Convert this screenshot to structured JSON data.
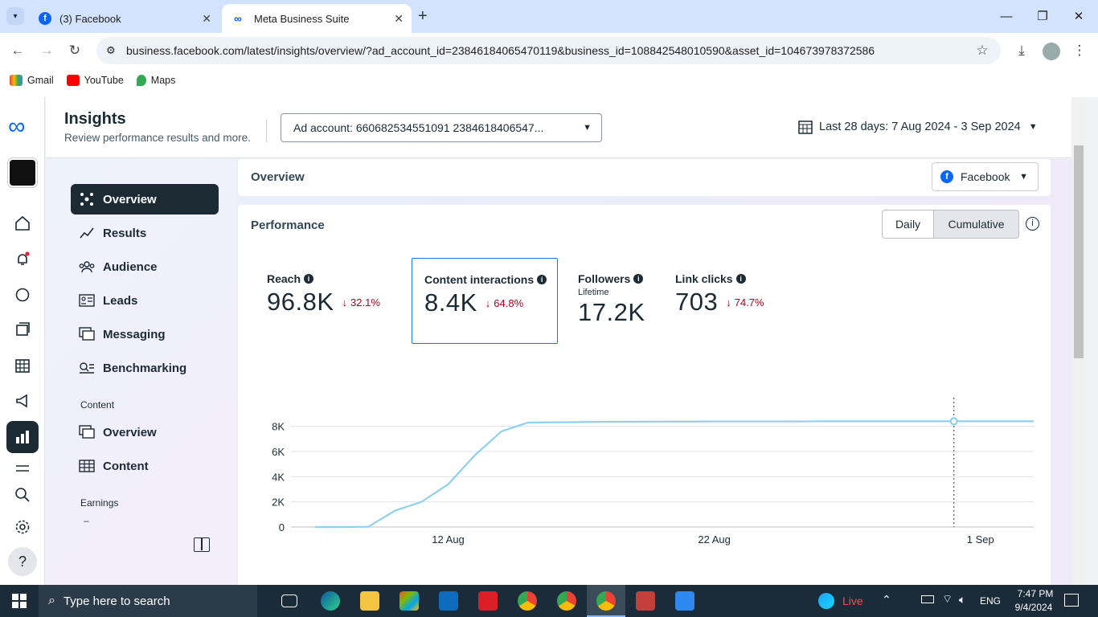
{
  "browser": {
    "tabs": [
      {
        "title": "(3) Facebook",
        "active": false
      },
      {
        "title": "Meta Business Suite",
        "active": true
      }
    ],
    "url": "business.facebook.com/latest/insights/overview/?ad_account_id=23846184065470119&business_id=108842548010590&asset_id=104673978372586",
    "bookmarks": [
      "Gmail",
      "YouTube",
      "Maps"
    ]
  },
  "header": {
    "title": "Insights",
    "subtitle": "Review performance results and more.",
    "ad_account": "Ad account: 660682534551091 2384618406547...",
    "date_range": "Last 28 days: 7 Aug 2024 - 3 Sep 2024"
  },
  "sidenav": {
    "items": [
      {
        "label": "Overview",
        "icon": "overview-icon",
        "active": true
      },
      {
        "label": "Results",
        "icon": "results-icon"
      },
      {
        "label": "Audience",
        "icon": "audience-icon"
      },
      {
        "label": "Leads",
        "icon": "leads-icon"
      },
      {
        "label": "Messaging",
        "icon": "messaging-icon"
      },
      {
        "label": "Benchmarking",
        "icon": "benchmarking-icon"
      }
    ],
    "content_section": "Content",
    "content_items": [
      {
        "label": "Overview",
        "icon": "content-overview-icon"
      },
      {
        "label": "Content",
        "icon": "content-table-icon"
      }
    ],
    "earnings_section": "Earnings",
    "earnings_dash": "–"
  },
  "overview": {
    "title": "Overview",
    "platform": "Facebook"
  },
  "performance": {
    "title": "Performance",
    "toggle": [
      "Daily",
      "Cumulative"
    ],
    "toggle_selected": "Cumulative",
    "metrics": [
      {
        "label": "Reach",
        "value": "96.8K",
        "delta": "32.1%",
        "selected": false
      },
      {
        "label": "Content interactions",
        "value": "8.4K",
        "delta": "64.8%",
        "selected": true
      },
      {
        "label": "Followers",
        "sublabel": "Lifetime",
        "value": "17.2K",
        "delta": ""
      },
      {
        "label": "Link clicks",
        "value": "703",
        "delta": "74.7%",
        "selected": false
      }
    ]
  },
  "chart_data": {
    "type": "line",
    "x": [
      "7 Aug",
      "8 Aug",
      "9 Aug",
      "10 Aug",
      "11 Aug",
      "12 Aug",
      "13 Aug",
      "14 Aug",
      "15 Aug",
      "16 Aug",
      "17 Aug",
      "18 Aug",
      "19 Aug",
      "20 Aug",
      "21 Aug",
      "22 Aug",
      "23 Aug",
      "24 Aug",
      "25 Aug",
      "26 Aug",
      "27 Aug",
      "28 Aug",
      "29 Aug",
      "30 Aug",
      "31 Aug",
      "1 Sep",
      "2 Sep",
      "3 Sep"
    ],
    "series": [
      {
        "values": [
          0,
          0,
          20,
          1300,
          2000,
          3400,
          5700,
          7600,
          8300,
          8320,
          8340,
          8360,
          8370,
          8380,
          8380,
          8390,
          8390,
          8390,
          8390,
          8400,
          8400,
          8400,
          8400,
          8400,
          8400,
          8400,
          8400,
          8400
        ]
      }
    ],
    "yticks": [
      "0",
      "2K",
      "4K",
      "6K",
      "8K"
    ],
    "xticks": [
      "12 Aug",
      "22 Aug",
      "1 Sep"
    ],
    "ylim": [
      0,
      8000
    ],
    "grid": true,
    "highlight_index": 24
  },
  "taskbar": {
    "search": "Type here to search",
    "live": "Live",
    "lang": "ENG",
    "time": "7:47 PM",
    "date": "9/4/2024"
  },
  "colors": {
    "line": "#8ed0ef",
    "nav_active": "#1c2b33",
    "meta_blue": "#0866ff",
    "delta_red": "#a8001b"
  }
}
